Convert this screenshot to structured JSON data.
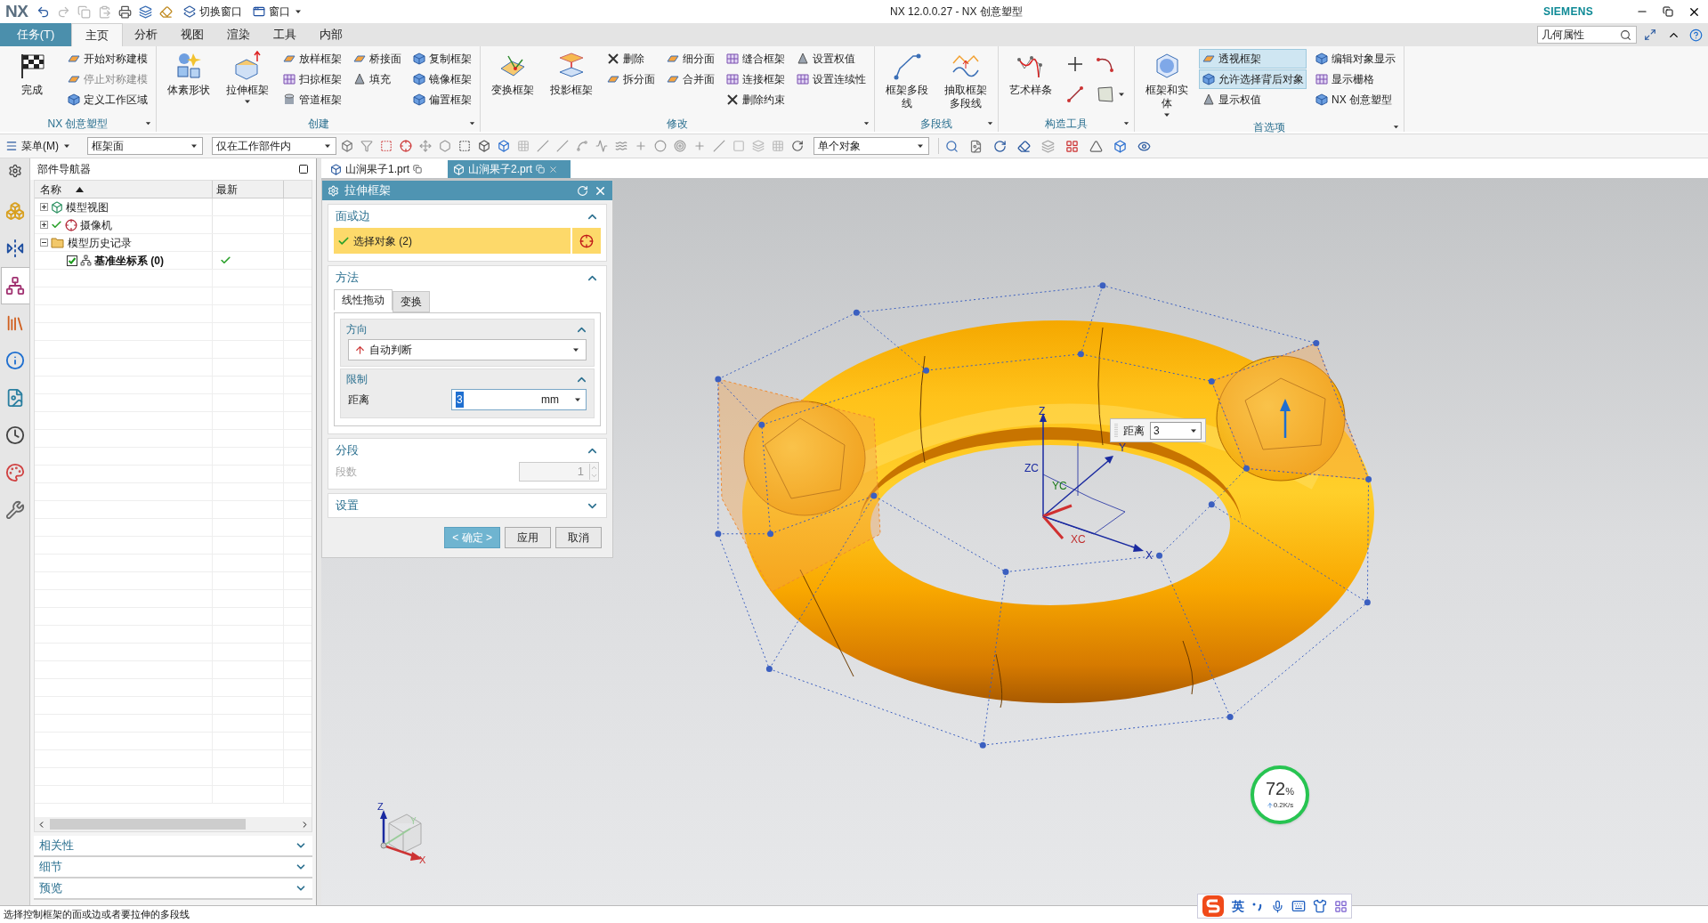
{
  "title_bar": {
    "logo": "NX",
    "quick_access": [
      {
        "label": "切换窗口"
      },
      {
        "label": "窗口"
      }
    ],
    "title": "NX 12.0.0.27 - NX 创意塑型",
    "brand": "SIEMENS"
  },
  "ribbon": {
    "tabs": [
      {
        "label": "任务(T)",
        "kind": "file",
        "selected": false
      },
      {
        "label": "主页",
        "kind": "tab",
        "selected": true
      },
      {
        "label": "分析",
        "kind": "tab",
        "selected": false
      },
      {
        "label": "视图",
        "kind": "tab",
        "selected": false
      },
      {
        "label": "渲染",
        "kind": "tab",
        "selected": false
      },
      {
        "label": "工具",
        "kind": "tab",
        "selected": false
      },
      {
        "label": "内部",
        "kind": "tab",
        "selected": false
      }
    ],
    "search": {
      "value": "几何属性"
    },
    "groups": [
      {
        "label": "NX 创意塑型",
        "columns": [
          [
            {
              "kind": "large",
              "label": "完成",
              "menu": false
            }
          ],
          [
            {
              "kind": "small",
              "label": "开始对称建模",
              "disabled": false
            },
            {
              "kind": "small",
              "label": "停止对称建模",
              "disabled": true
            },
            {
              "kind": "small",
              "label": "定义工作区域",
              "disabled": false
            }
          ]
        ]
      },
      {
        "label": "创建",
        "columns": [
          [
            {
              "kind": "large",
              "label": "体素形状",
              "menu": false
            }
          ],
          [
            {
              "kind": "large",
              "label": "拉伸框架",
              "menu": true
            }
          ],
          [
            {
              "kind": "small",
              "label": "放样框架"
            },
            {
              "kind": "small",
              "label": "扫掠框架"
            },
            {
              "kind": "small",
              "label": "管道框架"
            }
          ],
          [
            {
              "kind": "small",
              "label": "桥接面"
            },
            {
              "kind": "small",
              "label": "填充"
            }
          ],
          [
            {
              "kind": "small",
              "label": "复制框架"
            },
            {
              "kind": "small",
              "label": "镜像框架"
            },
            {
              "kind": "small",
              "label": "偏置框架"
            }
          ]
        ]
      },
      {
        "label": "修改",
        "columns": [
          [
            {
              "kind": "large",
              "label": "变换框架",
              "menu": false
            }
          ],
          [
            {
              "kind": "large",
              "label": "投影框架",
              "menu": false
            }
          ],
          [
            {
              "kind": "small",
              "label": "删除"
            },
            {
              "kind": "small",
              "label": "拆分面"
            }
          ],
          [
            {
              "kind": "small",
              "label": "细分面"
            },
            {
              "kind": "small",
              "label": "合并面"
            }
          ],
          [
            {
              "kind": "small",
              "label": "缝合框架"
            },
            {
              "kind": "small",
              "label": "连接框架"
            },
            {
              "kind": "small",
              "label": "删除约束"
            }
          ],
          [
            {
              "kind": "small",
              "label": "设置权值"
            },
            {
              "kind": "small",
              "label": "设置连续性"
            }
          ]
        ]
      },
      {
        "label": "多段线",
        "columns": [
          [
            {
              "kind": "large",
              "label": "框架多段线",
              "menu": false
            }
          ],
          [
            {
              "kind": "large",
              "label": "抽取框架多段线",
              "menu": false
            }
          ]
        ]
      },
      {
        "label": "构造工具",
        "columns": [
          [
            {
              "kind": "large",
              "label": "艺术样条",
              "menu": false
            }
          ],
          [
            {
              "kind": "icon",
              "menu": false
            },
            {
              "kind": "icon",
              "menu": false
            }
          ],
          [
            {
              "kind": "icon",
              "menu": false
            },
            {
              "kind": "icon",
              "menu": true
            }
          ]
        ]
      },
      {
        "label": "首选项",
        "columns": [
          [
            {
              "kind": "large",
              "label": "框架和实体",
              "menu": true
            }
          ],
          [
            {
              "kind": "small",
              "label": "透视框架",
              "selected": true
            },
            {
              "kind": "small",
              "label": "允许选择背后对象",
              "selected": true
            },
            {
              "kind": "small",
              "label": "显示权值",
              "selected": false
            }
          ],
          [
            {
              "kind": "small",
              "label": "编辑对象显示"
            },
            {
              "kind": "small",
              "label": "显示栅格"
            },
            {
              "kind": "small",
              "label": "NX 创意塑型"
            }
          ]
        ]
      }
    ]
  },
  "toolbar": {
    "menu_button": "菜单(M)",
    "filters": [
      {
        "value": "框架面"
      },
      {
        "value": "仅在工作部件内"
      }
    ],
    "selection_scope": {
      "value": "单个对象"
    }
  },
  "resource_bar": [
    {
      "selected": false
    },
    {
      "selected": false
    },
    {
      "selected": true
    },
    {
      "selected": false
    },
    {
      "selected": false
    },
    {
      "selected": false
    },
    {
      "selected": false
    },
    {
      "selected": false
    },
    {
      "selected": false
    }
  ],
  "navigator": {
    "title": "部件导航器",
    "columns": [
      "名称",
      "最新"
    ],
    "tree": [
      {
        "label": "模型视图",
        "expanded": false,
        "ticked": false
      },
      {
        "label": "摄像机",
        "expanded": false,
        "ticked": true
      },
      {
        "label": "模型历史记录",
        "expanded": true,
        "ticked": false,
        "children": [
          {
            "label": "基准坐标系 (0)",
            "checked": true,
            "up_to_date": true
          }
        ]
      }
    ],
    "panels": [
      {
        "label": "相关性",
        "expanded": false
      },
      {
        "label": "细节",
        "expanded": false
      },
      {
        "label": "预览",
        "expanded": false
      }
    ]
  },
  "documents": [
    {
      "label": "山涧果子1.prt",
      "selected": false
    },
    {
      "label": "山涧果子2.prt",
      "selected": true
    }
  ],
  "dialog": {
    "title": "拉伸框架",
    "sections": [
      {
        "kind": "selection",
        "title": "面或边",
        "expanded": true,
        "selection": {
          "label": "选择对象 (2)",
          "complete": true
        }
      },
      {
        "kind": "method",
        "title": "方法",
        "expanded": true,
        "tabs": [
          {
            "label": "线性拖动",
            "selected": true
          },
          {
            "label": "变换",
            "selected": false
          }
        ],
        "subsections": [
          {
            "kind": "direction",
            "title": "方向",
            "expanded": true,
            "value": "自动判断"
          },
          {
            "kind": "limit",
            "title": "限制",
            "expanded": true,
            "label": "距离",
            "value": "3",
            "unit": "mm"
          }
        ]
      },
      {
        "kind": "segments",
        "title": "分段",
        "expanded": true,
        "label": "段数",
        "value": "1",
        "disabled": true
      },
      {
        "kind": "settings",
        "title": "设置",
        "expanded": false
      }
    ],
    "buttons": [
      {
        "label": "< 确定 >",
        "kind": "primary"
      },
      {
        "label": "应用",
        "kind": "normal"
      },
      {
        "label": "取消",
        "kind": "normal"
      }
    ]
  },
  "viewport": {
    "csys_labels": {
      "z": "Z",
      "zc": "ZC",
      "yc": "YC",
      "y": "Y",
      "xc": "XC",
      "x": "X"
    },
    "distance_input": {
      "label": "距离",
      "value": "3"
    },
    "triad_labels": {
      "z": "Z",
      "y": "Y",
      "x": "X"
    },
    "monitor": {
      "value": "72",
      "unit": "%",
      "speed": "0.2K/s"
    }
  },
  "ime": {
    "mode": "英"
  },
  "status_bar": {
    "prompt": "选择控制框架的面或边或者要拉伸的多段线"
  }
}
